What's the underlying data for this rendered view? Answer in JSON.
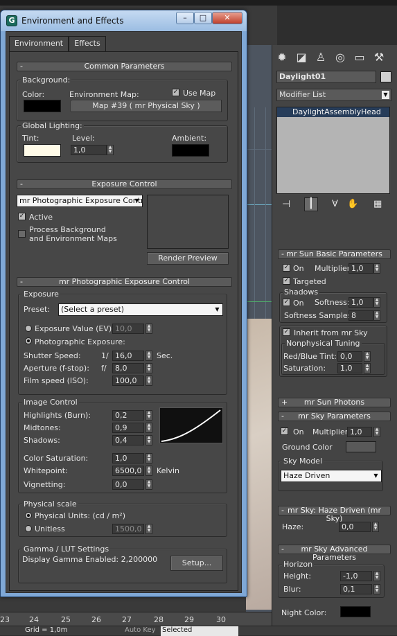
{
  "dialog": {
    "title": "Environment and Effects",
    "app_icon": "G",
    "tabs": [
      "Environment",
      "Effects"
    ]
  },
  "common": {
    "rollout_title": "Common Parameters",
    "background_label": "Background:",
    "color_label": "Color:",
    "env_map_label": "Environment Map:",
    "use_map_label": "Use Map",
    "env_map_button": "Map #39  ( mr Physical Sky )",
    "global_lighting_label": "Global Lighting:",
    "tint_label": "Tint:",
    "level_label": "Level:",
    "level_value": "1,0",
    "ambient_label": "Ambient:",
    "colors": {
      "background": "#000000",
      "tint": "#fffbe8",
      "ambient": "#000000"
    }
  },
  "exposure_control": {
    "rollout_title": "Exposure Control",
    "selected": "mr Photographic Exposure Contro",
    "active_label": "Active",
    "process_bg_label": "Process Background\nand Environment Maps",
    "process_bg_line1": "Process Background",
    "process_bg_line2": "and Environment Maps",
    "render_preview": "Render Preview"
  },
  "mr_photo": {
    "rollout_title": "mr Photographic Exposure Control",
    "exposure_group": "Exposure",
    "preset_label": "Preset:",
    "preset_value": "(Select a preset)",
    "ev_label": "Exposure Value (EV):",
    "ev_value": "10,0",
    "photo_exposure_label": "Photographic Exposure:",
    "shutter_label": "Shutter Speed:",
    "shutter_prefix": "1/",
    "shutter_value": "16,0",
    "shutter_unit": "Sec.",
    "aperture_label": "Aperture (f-stop):",
    "aperture_prefix": "f/",
    "aperture_value": "8,0",
    "film_label": "Film speed (ISO):",
    "film_value": "100,0",
    "image_control_group": "Image Control",
    "highlights_label": "Highlights (Burn):",
    "highlights_value": "0,2",
    "midtones_label": "Midtones:",
    "midtones_value": "0,9",
    "shadows_label": "Shadows:",
    "shadows_value": "0,4",
    "color_sat_label": "Color Saturation:",
    "color_sat_value": "1,0",
    "whitepoint_label": "Whitepoint:",
    "whitepoint_value": "6500,0",
    "whitepoint_unit": "Kelvin",
    "vignetting_label": "Vignetting:",
    "vignetting_value": "0,0",
    "physical_scale_group": "Physical scale",
    "physical_units_label": "Physical Units: (cd / m²)",
    "unitless_label": "Unitless",
    "unitless_value": "1500,0",
    "gamma_group": "Gamma / LUT Settings",
    "gamma_text": "Display Gamma Enabled:  2,200000",
    "setup_button": "Setup..."
  },
  "timeline": {
    "ticks": [
      "23",
      "24",
      "25",
      "26",
      "27",
      "28",
      "29",
      "30"
    ]
  },
  "status": {
    "grid": "Grid = 1,0m",
    "autokey": "Auto Key",
    "selected": "Selected"
  },
  "command_panel": {
    "object_name": "Daylight01",
    "modifier_list": "Modifier List",
    "stack_item": "DaylightAssemblyHead",
    "sun_basic": {
      "title": "mr Sun Basic Parameters",
      "on_label": "On",
      "multiplier_label": "Multiplier:",
      "multiplier_value": "1,0",
      "targeted_label": "Targeted",
      "shadows_group": "Shadows",
      "shadows_on": "On",
      "softness_label": "Softness:",
      "softness_value": "1,0",
      "samples_label": "Softness Samples:",
      "samples_value": "8",
      "inherit_label": "Inherit from mr Sky",
      "nonphys_group": "Nonphysical Tuning",
      "redblue_label": "Red/Blue Tint:",
      "redblue_value": "0,0",
      "saturation_label": "Saturation:",
      "saturation_value": "1,0"
    },
    "sun_photons": {
      "title": "mr Sun Photons"
    },
    "sky_params": {
      "title": "mr Sky Parameters",
      "on_label": "On",
      "multiplier_label": "Multiplier:",
      "multiplier_value": "1,0",
      "ground_color_label": "Ground Color",
      "sky_model_group": "Sky Model",
      "sky_model_value": "Haze Driven"
    },
    "haze": {
      "title": "mr Sky: Haze Driven (mr Sky)",
      "haze_label": "Haze:",
      "haze_value": "0,0"
    },
    "advanced": {
      "title": "mr Sky Advanced Parameters",
      "horizon_group": "Horizon",
      "height_label": "Height:",
      "height_value": "-1,0",
      "blur_label": "Blur:",
      "blur_value": "0,1",
      "night_color_label": "Night Color:"
    }
  }
}
